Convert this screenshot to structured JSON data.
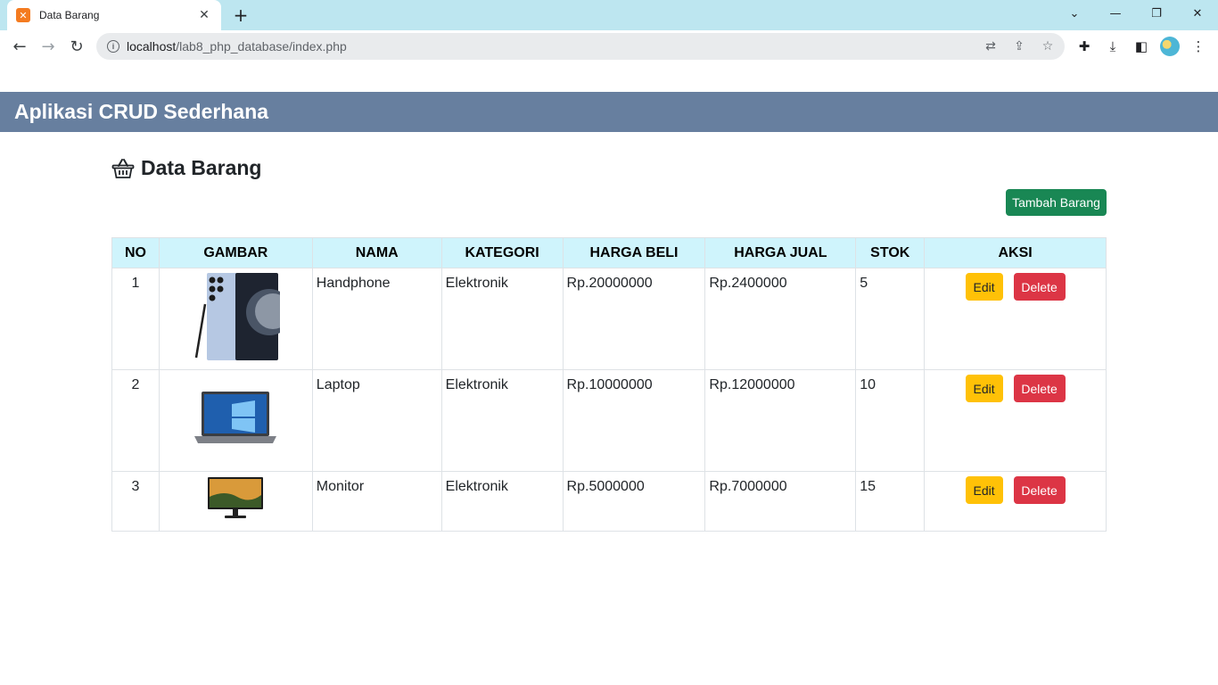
{
  "browser": {
    "tab_title": "Data Barang",
    "tab_favicon": "xampp-icon",
    "url_host": "localhost",
    "url_path": "/lab8_php_database/index.php"
  },
  "app": {
    "header_title": "Aplikasi CRUD Sederhana",
    "page_title": "Data Barang",
    "page_icon": "basket-icon",
    "add_button": "Tambah Barang"
  },
  "table": {
    "columns": [
      "NO",
      "GAMBAR",
      "NAMA",
      "KATEGORI",
      "HARGA BELI",
      "HARGA JUAL",
      "STOK",
      "AKSI"
    ],
    "rows": [
      {
        "no": "1",
        "image": "phone-image",
        "nama": "Handphone",
        "kategori": "Elektronik",
        "harga_beli": "Rp.20000000",
        "harga_jual": "Rp.2400000",
        "stok": "5"
      },
      {
        "no": "2",
        "image": "laptop-image",
        "nama": "Laptop",
        "kategori": "Elektronik",
        "harga_beli": "Rp.10000000",
        "harga_jual": "Rp.12000000",
        "stok": "10"
      },
      {
        "no": "3",
        "image": "monitor-image",
        "nama": "Monitor",
        "kategori": "Elektronik",
        "harga_beli": "Rp.5000000",
        "harga_jual": "Rp.7000000",
        "stok": "15"
      }
    ],
    "edit_label": "Edit",
    "delete_label": "Delete"
  },
  "colors": {
    "header_bg": "#677f9f",
    "table_head_bg": "#cff4fc",
    "add_button": "#198754",
    "edit_button": "#ffc107",
    "delete_button": "#dc3545"
  }
}
